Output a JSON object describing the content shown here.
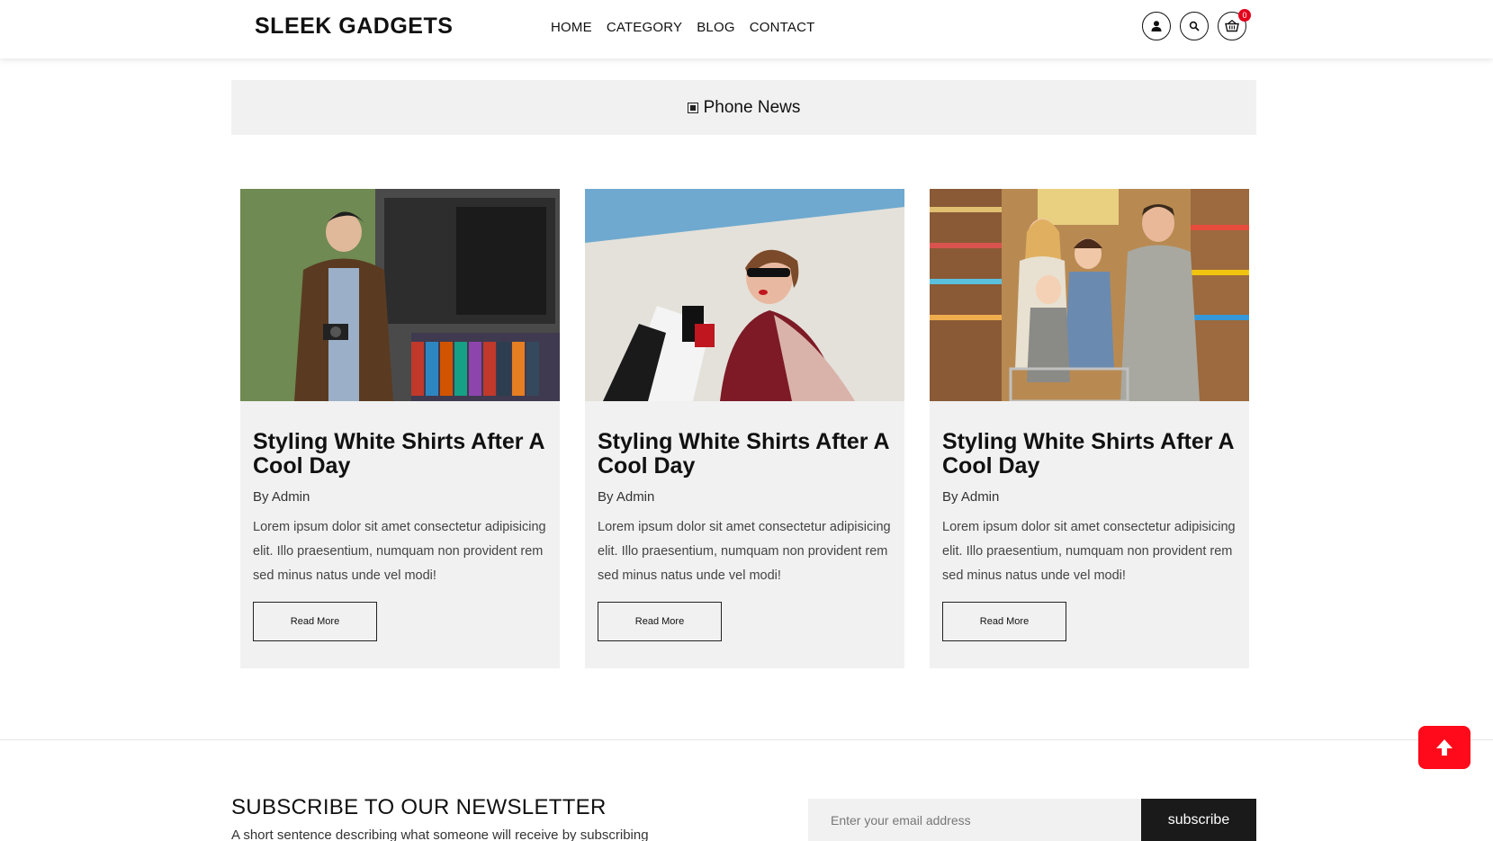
{
  "brand": {
    "name": "SLEEK GADGETS"
  },
  "nav": {
    "items": [
      "HOME",
      "CATEGORY",
      "BLOG",
      "CONTACT"
    ]
  },
  "header_icons": {
    "account": "user-icon",
    "search": "search-icon",
    "cart": "cart-icon",
    "cart_count": "0"
  },
  "section": {
    "title": "Phone News",
    "marker_icon": "square-icon"
  },
  "posts": [
    {
      "title": "Styling White Shirts After A Cool Day",
      "author": "By Admin",
      "excerpt": "Lorem ipsum dolor sit amet consectetur adipisicing elit. Illo praesentium, numquam non provident rem sed minus natus unde vel modi!",
      "button": "Read More"
    },
    {
      "title": "Styling White Shirts After A Cool Day",
      "author": "By Admin",
      "excerpt": "Lorem ipsum dolor sit amet consectetur adipisicing elit. Illo praesentium, numquam non provident rem sed minus natus unde vel modi!",
      "button": "Read More"
    },
    {
      "title": "Styling White Shirts After A Cool Day",
      "author": "By Admin",
      "excerpt": "Lorem ipsum dolor sit amet consectetur adipisicing elit. Illo praesentium, numquam non provident rem sed minus natus unde vel modi!",
      "button": "Read More"
    }
  ],
  "newsletter": {
    "title": "SUBSCRIBE TO OUR NEWSLETTER",
    "subtitle": "A short sentence describing what someone will receive by subscribing",
    "placeholder": "Enter your email address",
    "button": "subscribe"
  },
  "scroll_top": {
    "icon": "arrow-up-icon"
  },
  "colors": {
    "accent_red": "#ff0a1a",
    "badge_red": "#e3001b",
    "card_bg": "#f1f1f1",
    "dark": "#1a1a1a"
  }
}
